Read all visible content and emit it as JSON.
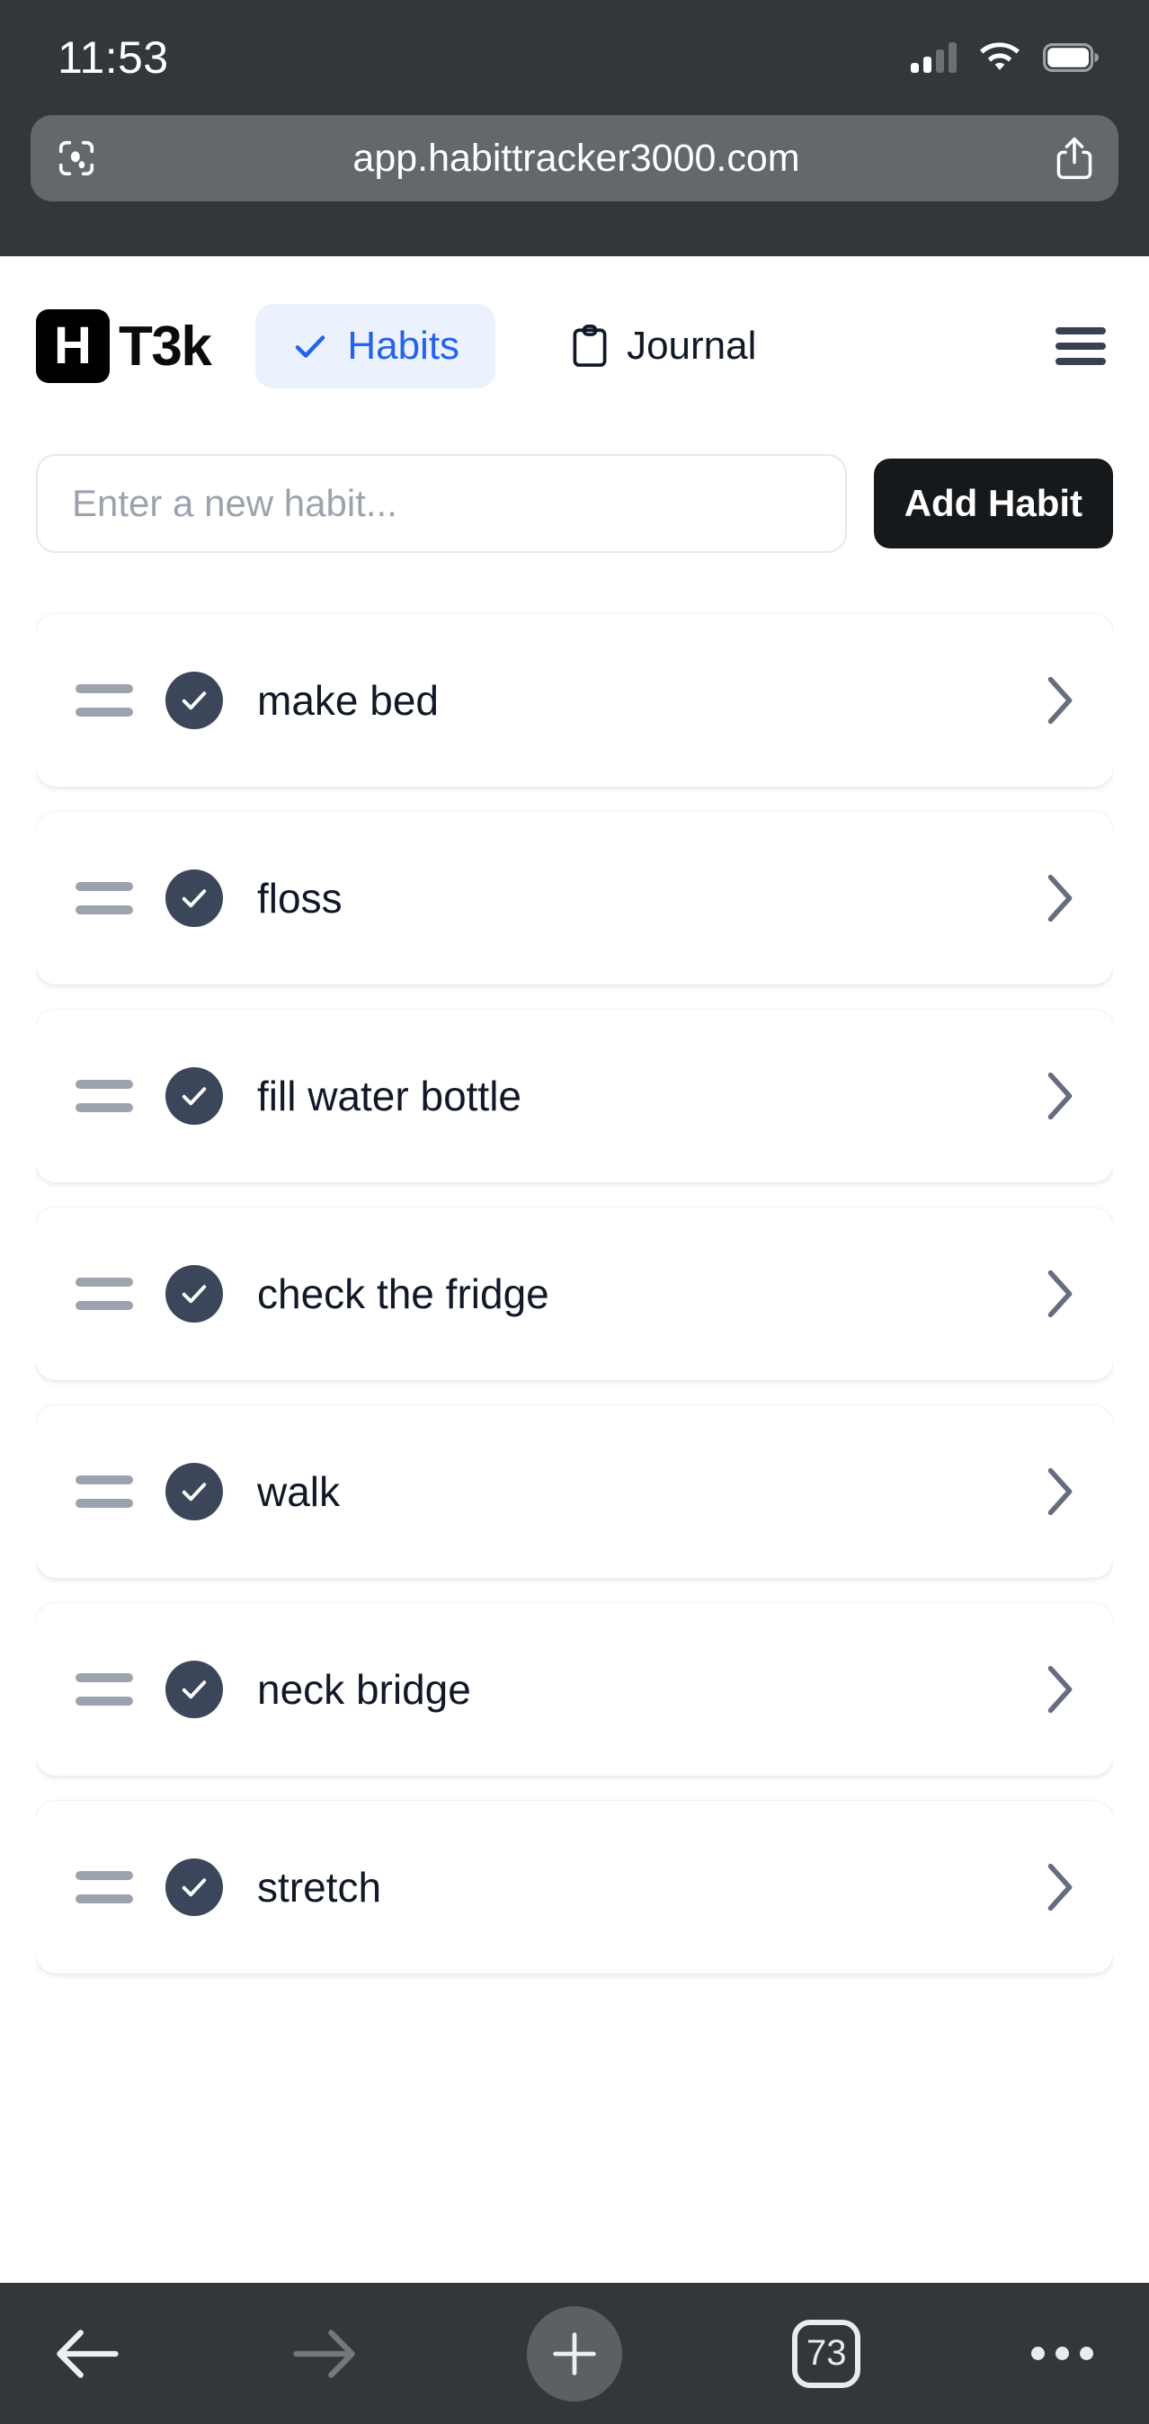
{
  "status_bar": {
    "time": "11:53",
    "signal_icon": "cellular-signal-icon",
    "wifi_icon": "wifi-icon",
    "battery_icon": "battery-icon"
  },
  "browser": {
    "url": "app.habittracker3000.com",
    "scan_icon": "scan-camera-icon",
    "share_icon": "share-icon",
    "toolbar": {
      "back_icon": "back-arrow-icon",
      "forward_icon": "forward-arrow-icon",
      "new_tab_icon": "plus-icon",
      "tab_count": "73",
      "more_icon": "more-dots-icon"
    }
  },
  "app": {
    "brand": {
      "mark": "H",
      "name": "T3k"
    },
    "tabs": [
      {
        "label": "Habits",
        "icon": "check-icon",
        "active": true
      },
      {
        "label": "Journal",
        "icon": "clipboard-icon",
        "active": false
      }
    ],
    "menu_icon": "hamburger-menu-icon",
    "add_habit": {
      "placeholder": "Enter a new habit...",
      "value": "",
      "button_label": "Add Habit"
    },
    "habits": [
      {
        "name": "make bed",
        "completed": true
      },
      {
        "name": "floss",
        "completed": true
      },
      {
        "name": "fill water bottle",
        "completed": true
      },
      {
        "name": "check the fridge",
        "completed": true
      },
      {
        "name": "walk",
        "completed": true
      },
      {
        "name": "neck bridge",
        "completed": true
      },
      {
        "name": "stretch",
        "completed": true
      }
    ]
  },
  "colors": {
    "chrome": "#31373A",
    "url_bar": "#63686B",
    "accent_blue": "#2563EB",
    "tab_active_bg": "#EBF2FD",
    "check_circle": "#3C465A",
    "add_button": "#16191C",
    "text_primary": "#111827",
    "muted": "#9CA3AF"
  }
}
